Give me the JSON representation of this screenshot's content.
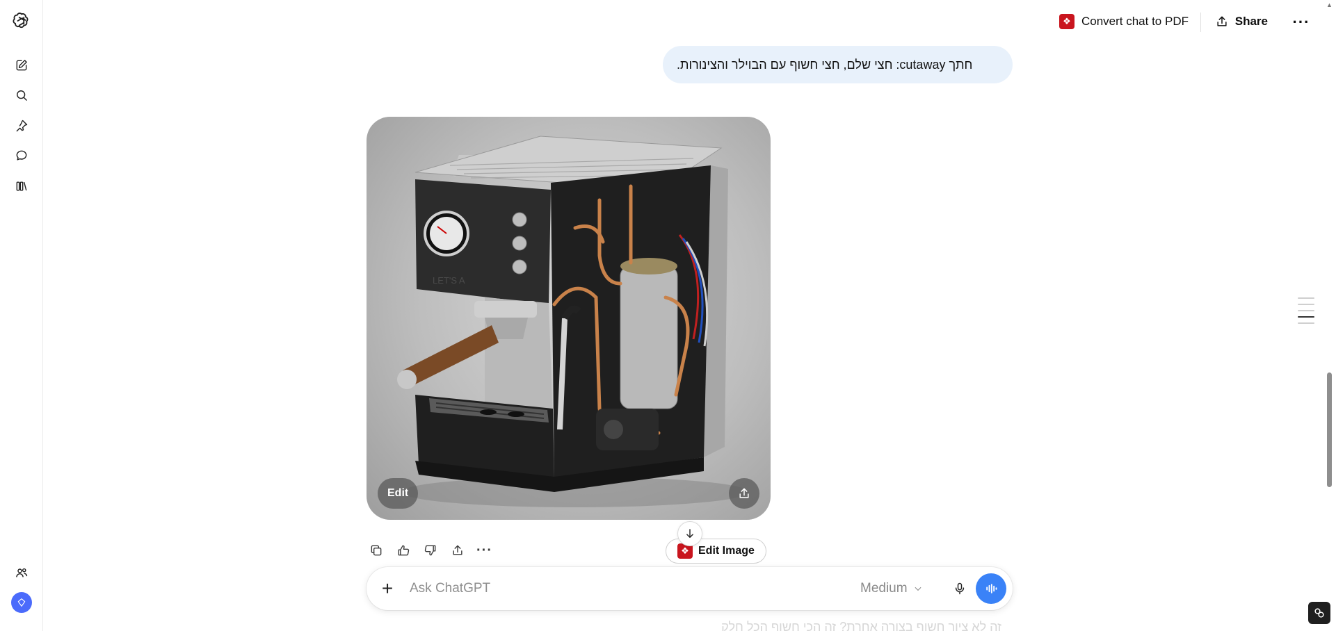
{
  "sidebar": {
    "logo_icon": "openai-logo-icon",
    "items": [
      {
        "icon": "new-chat-icon"
      },
      {
        "icon": "search-icon"
      },
      {
        "icon": "pin-icon"
      },
      {
        "icon": "chat-bubble-icon"
      },
      {
        "icon": "library-icon"
      }
    ],
    "bottom": [
      {
        "icon": "people-icon"
      },
      {
        "icon": "avatar-icon"
      }
    ]
  },
  "topbar": {
    "convert_label": "Convert chat to PDF",
    "share_label": "Share",
    "more_label": "···"
  },
  "user_message": "חתך cutaway: חצי שלם, חצי חשוף עם הבוילר והצינורות.",
  "image_card": {
    "edit_label": "Edit",
    "watermark": "LET'S A"
  },
  "actions": {
    "more_label": "···"
  },
  "edit_image_chip": {
    "label": "Edit Image"
  },
  "composer": {
    "plus_label": "+",
    "placeholder": "Ask ChatGPT",
    "model_label": "Medium"
  },
  "faded_text": "זה לא ציור חשוף בצורה אחרת? זה הכי חשוף הכל חלק",
  "colors": {
    "bubble": "#e8f1fb",
    "accent_blue": "#3a82f7",
    "pdf_red": "#c9151e"
  }
}
